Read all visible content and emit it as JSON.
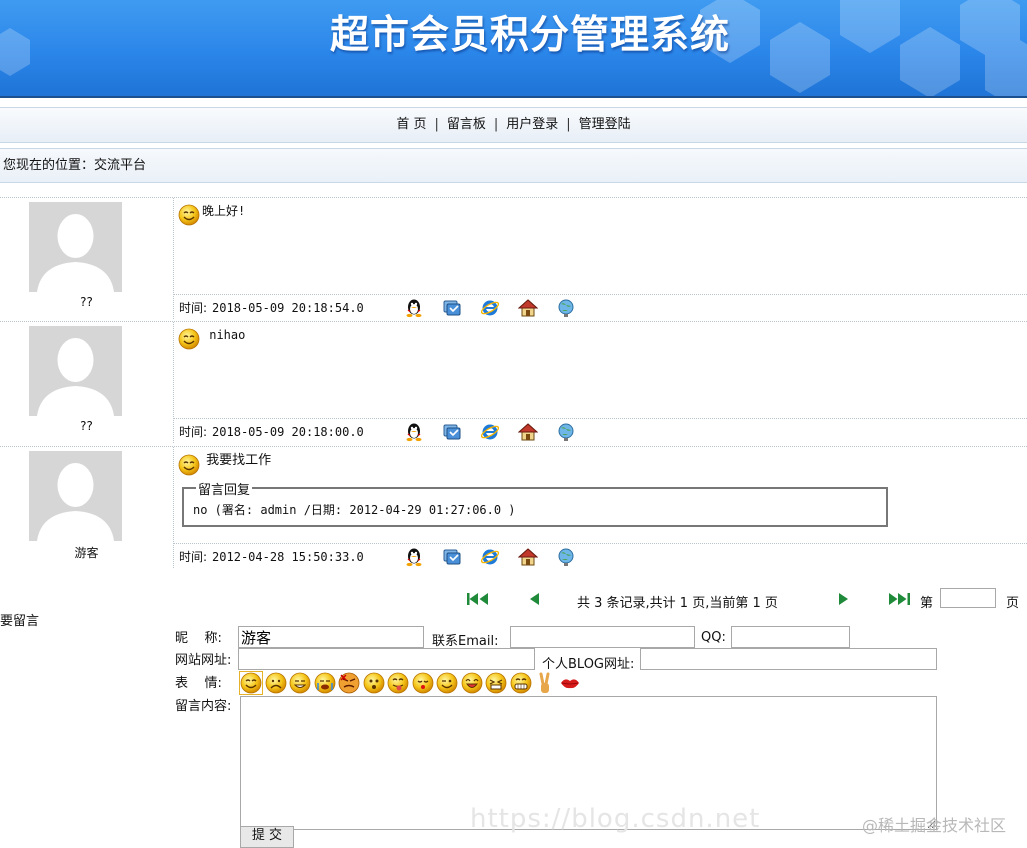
{
  "banner": {
    "title": "超市会员积分管理系统"
  },
  "nav": {
    "items": [
      "首 页",
      "留言板",
      "用户登录",
      "管理登陆"
    ],
    "separator": "|"
  },
  "location": {
    "text": "您现在的位置：交流平台"
  },
  "messages": [
    {
      "author": "??",
      "text": "晚上好!",
      "time_label": "时间:",
      "time": "2018-05-09 20:18:54.0"
    },
    {
      "author": "??",
      "text": " nihao",
      "time_label": "时间:",
      "time": "2018-05-09 20:18:00.0"
    },
    {
      "author": "游客",
      "text": " 我要找工作",
      "time_label": "时间:",
      "time": "2012-04-28 15:50:33.0",
      "reply": {
        "title": "留言回复",
        "text": "no (署名: admin /日期: 2012-04-29 01:27:06.0 )"
      }
    }
  ],
  "footer_icons": [
    "qq-icon",
    "msn-icon",
    "ie-icon",
    "home-icon",
    "globe-icon"
  ],
  "pager": {
    "info": "共 3 条记录,共计 1 页,当前第 1 页",
    "goto_prefix": "第",
    "goto_suffix": "页",
    "goto_value": ""
  },
  "form": {
    "title": "要留言",
    "nickname_label": "昵    称:",
    "nickname_value": "游客",
    "email_label": "联系Email:",
    "email_value": "",
    "qq_label": "QQ:",
    "qq_value": "",
    "site_label": "网站网址:",
    "site_value": "",
    "blog_label": "个人BLOG网址:",
    "blog_value": "",
    "emotion_label": "表    情:",
    "emotions": [
      "smile-icon",
      "sad-icon",
      "grin-icon",
      "cry-icon",
      "angry-icon",
      "shocked-icon",
      "tongue-icon",
      "kiss-face-icon",
      "wink-icon",
      "laugh-icon",
      "grimace-icon",
      "teeth-icon",
      "victory-hand-icon",
      "lips-icon"
    ],
    "content_label": "留言内容:",
    "submit_label": "提 交"
  },
  "watermark": "@稀土掘金技术社区",
  "colors": {
    "banner": "#2b86ea",
    "nav_bg": "#e7eef6",
    "accent_green": "#1f8a3a"
  }
}
